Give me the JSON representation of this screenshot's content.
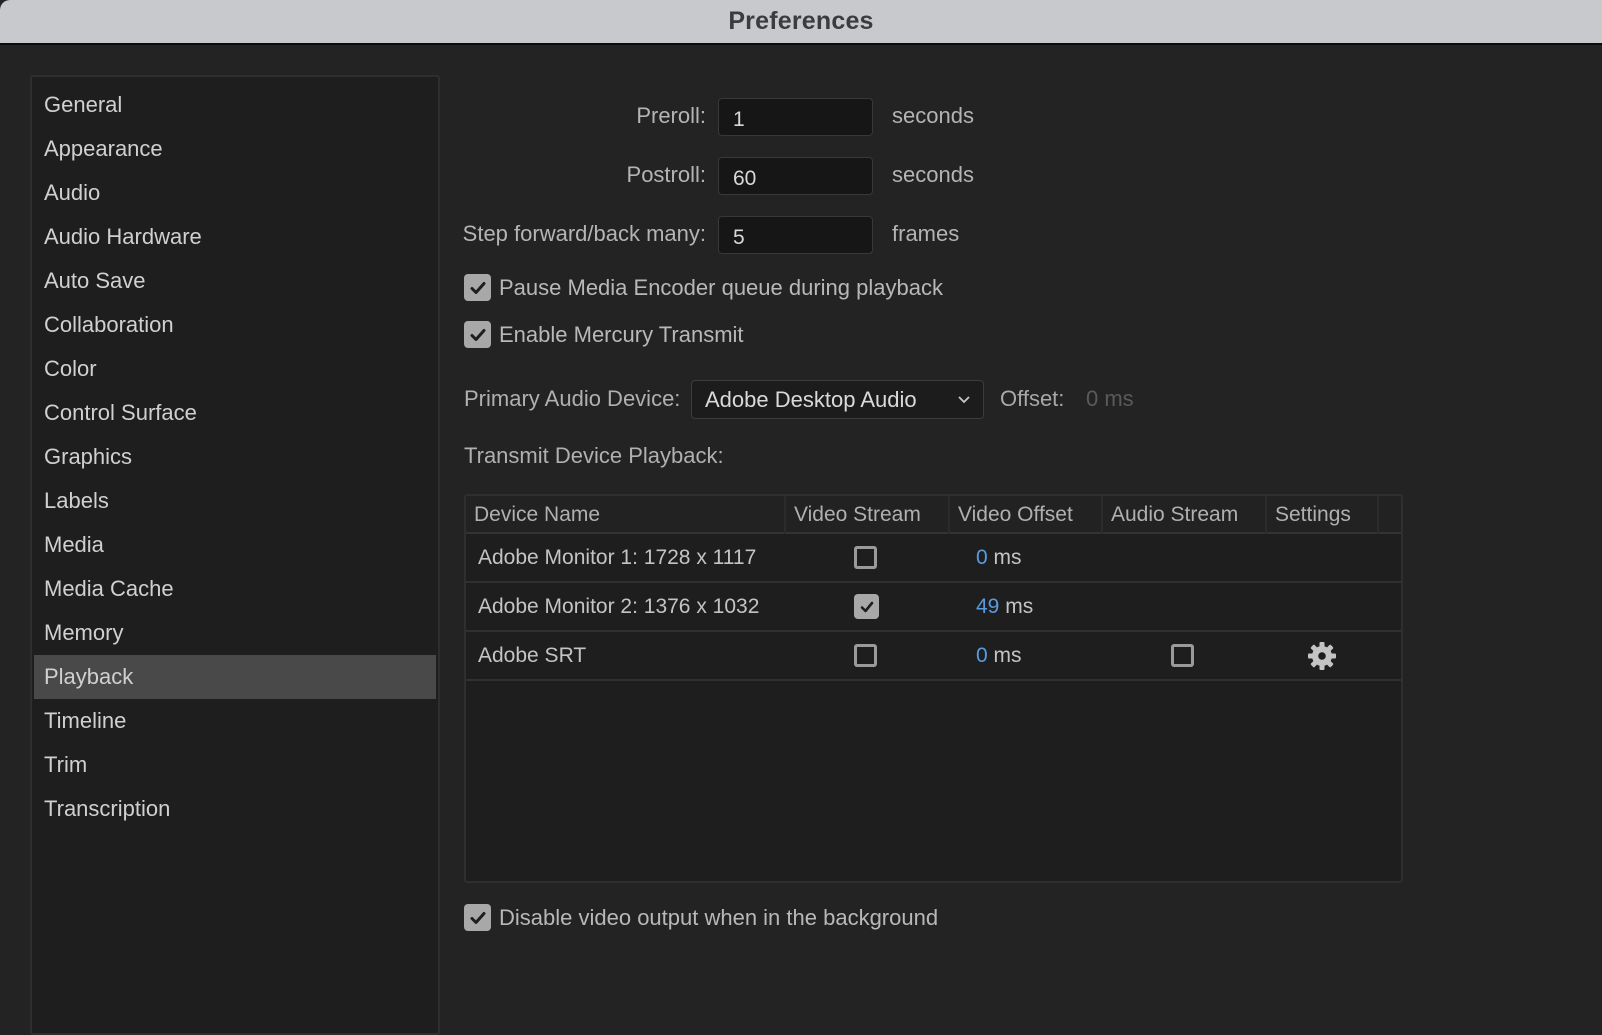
{
  "window": {
    "title": "Preferences"
  },
  "sidebar": {
    "selected": "Playback",
    "items": [
      {
        "label": "General"
      },
      {
        "label": "Appearance"
      },
      {
        "label": "Audio"
      },
      {
        "label": "Audio Hardware"
      },
      {
        "label": "Auto Save"
      },
      {
        "label": "Collaboration"
      },
      {
        "label": "Color"
      },
      {
        "label": "Control Surface"
      },
      {
        "label": "Graphics"
      },
      {
        "label": "Labels"
      },
      {
        "label": "Media"
      },
      {
        "label": "Media Cache"
      },
      {
        "label": "Memory"
      },
      {
        "label": "Playback"
      },
      {
        "label": "Timeline"
      },
      {
        "label": "Trim"
      },
      {
        "label": "Transcription"
      }
    ]
  },
  "playback": {
    "preroll": {
      "label": "Preroll:",
      "value": "1",
      "unit": "seconds"
    },
    "postroll": {
      "label": "Postroll:",
      "value": "60",
      "unit": "seconds"
    },
    "step": {
      "label": "Step forward/back many:",
      "value": "5",
      "unit": "frames"
    },
    "pause_encoder": {
      "label": "Pause Media Encoder queue during playback",
      "checked": true
    },
    "mercury_transmit": {
      "label": "Enable Mercury Transmit",
      "checked": true
    },
    "primary_audio": {
      "label": "Primary Audio Device:",
      "selected": "Adobe Desktop Audio",
      "offset_label": "Offset:",
      "offset_value": "0 ms"
    },
    "transmit_label": "Transmit Device Playback:",
    "table": {
      "headers": [
        "Device Name",
        "Video Stream",
        "Video Offset",
        "Audio Stream",
        "Settings"
      ],
      "rows": [
        {
          "name": "Adobe Monitor 1: 1728 x 1117",
          "video_stream": false,
          "video_offset": "0",
          "offset_unit": "ms",
          "audio_stream": null,
          "settings": false
        },
        {
          "name": "Adobe Monitor 2: 1376 x 1032",
          "video_stream": true,
          "video_offset": "49",
          "offset_unit": "ms",
          "audio_stream": null,
          "settings": false
        },
        {
          "name": "Adobe SRT",
          "video_stream": false,
          "video_offset": "0",
          "offset_unit": "ms",
          "audio_stream": false,
          "settings": true
        }
      ]
    },
    "disable_background": {
      "label": "Disable video output when in the background",
      "checked": true
    }
  },
  "colors": {
    "accent_value": "#5a9be0",
    "selected_row": "#494949",
    "titlebar": "#c8c9cc"
  },
  "icons": {
    "check": "checkmark-icon",
    "chevron": "chevron-down-icon",
    "gear": "gear-icon"
  }
}
